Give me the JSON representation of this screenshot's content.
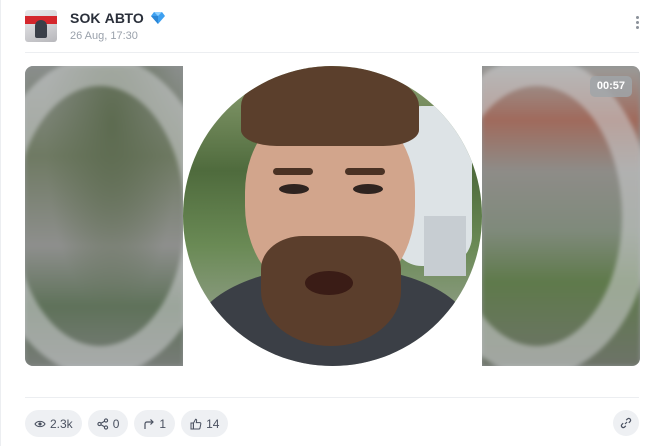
{
  "post": {
    "channel_name": "SOK АВТО",
    "date": "26 Aug, 17:30",
    "verified_badge_icon": "diamond-icon",
    "more_icon": "vertical-dots-icon",
    "media": {
      "type": "round-video",
      "duration": "00:57"
    },
    "stats": {
      "views": "2.3k",
      "shares": "0",
      "forwards": "1",
      "reactions": "14"
    },
    "icons": {
      "views": "eye-icon",
      "shares": "share-icon",
      "forwards": "forward-arrow-icon",
      "reactions": "thumbs-up-icon",
      "link": "link-icon"
    },
    "colors": {
      "badge": "#3ea0f0",
      "pill_bg": "#eef0f3",
      "text_muted": "#9aa1ab"
    }
  }
}
